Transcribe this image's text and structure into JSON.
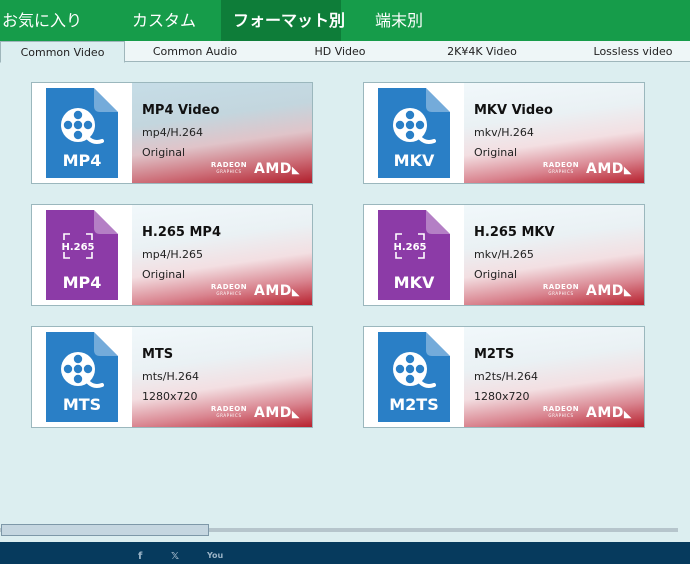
{
  "top_tabs": [
    {
      "label": "お気に入り"
    },
    {
      "label": "カスタム"
    },
    {
      "label": "フォーマット別"
    },
    {
      "label": "端末別"
    }
  ],
  "active_top_tab": "フォーマット別",
  "sub_tabs": [
    {
      "label": "Common Video"
    },
    {
      "label": "Common Audio"
    },
    {
      "label": "HD Video"
    },
    {
      "label": "2K¥4K Video"
    },
    {
      "label": "Lossless video"
    }
  ],
  "active_sub_tab": "Common Video",
  "badge": {
    "radeon": "RADEON",
    "graphics": "GRAPHICS",
    "amd": "AMD"
  },
  "formats": [
    {
      "title": "MP4 Video",
      "codec": "mp4/H.264",
      "detail": "Original",
      "icon_label": "MP4",
      "icon_kind": "film-reel-icon",
      "icon_color": "#2a7fc6"
    },
    {
      "title": "MKV Video",
      "codec": "mkv/H.264",
      "detail": "Original",
      "icon_label": "MKV",
      "icon_kind": "film-reel-icon",
      "icon_color": "#2a7fc6"
    },
    {
      "title": "H.265 MP4",
      "codec": "mp4/H.265",
      "detail": "Original",
      "icon_label": "MP4",
      "icon_kind": "h265-icon",
      "icon_badge": "H.265",
      "icon_color": "#8c3ba7"
    },
    {
      "title": "H.265 MKV",
      "codec": "mkv/H.265",
      "detail": "Original",
      "icon_label": "MKV",
      "icon_kind": "h265-icon",
      "icon_badge": "H.265",
      "icon_color": "#8c3ba7"
    },
    {
      "title": "MTS",
      "codec": "mts/H.264",
      "detail": "1280x720",
      "icon_label": "MTS",
      "icon_kind": "film-reel-icon",
      "icon_color": "#2a7fc6"
    },
    {
      "title": "M2TS",
      "codec": "m2ts/H.264",
      "detail": "1280x720",
      "icon_label": "M2TS",
      "icon_kind": "film-reel-icon",
      "icon_color": "#2a7fc6"
    }
  ],
  "footer": {
    "social": [
      {
        "label": "f",
        "icon": "facebook-icon"
      },
      {
        "label": "𝕏",
        "icon": "x-twitter-icon"
      },
      {
        "label": "You",
        "icon": "youtube-icon"
      }
    ]
  }
}
